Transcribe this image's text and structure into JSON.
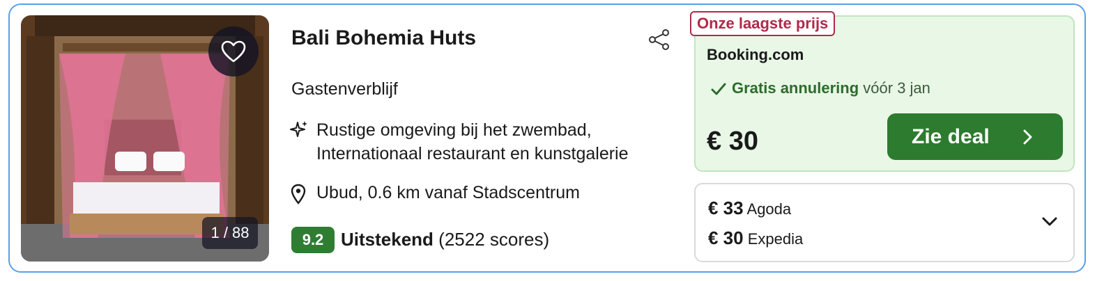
{
  "hotel": {
    "name": "Bali Bohemia Huts",
    "type": "Gastenverblijf",
    "feature": "Rustige omgeving bij het zwembad, Internationaal restaurant en kunstgalerie",
    "location": "Ubud, 0.6 km vanaf Stadscentrum",
    "score": "9.2",
    "rating_label": "Uitstekend",
    "rating_count": "(2522 scores)"
  },
  "photo": {
    "counter": "1 / 88",
    "icons": {
      "favorite": "heart-icon",
      "share": "share-icon"
    }
  },
  "deal": {
    "badge": "Onze laagste prijs",
    "provider": "Booking.com",
    "cancellation": "Gratis annulering",
    "cancellation_until": "vóór 3 jan",
    "price": "€ 30",
    "button_label": "Zie deal"
  },
  "other_offers": [
    {
      "price": "€ 33",
      "provider": "Agoda"
    },
    {
      "price": "€ 30",
      "provider": "Expedia"
    }
  ],
  "colors": {
    "card_border": "#5aa0e6",
    "score_green": "#2f7d32",
    "deal_bg": "#e9f7e7",
    "badge_red": "#b02a4a",
    "button_green": "#2d7b2f"
  }
}
